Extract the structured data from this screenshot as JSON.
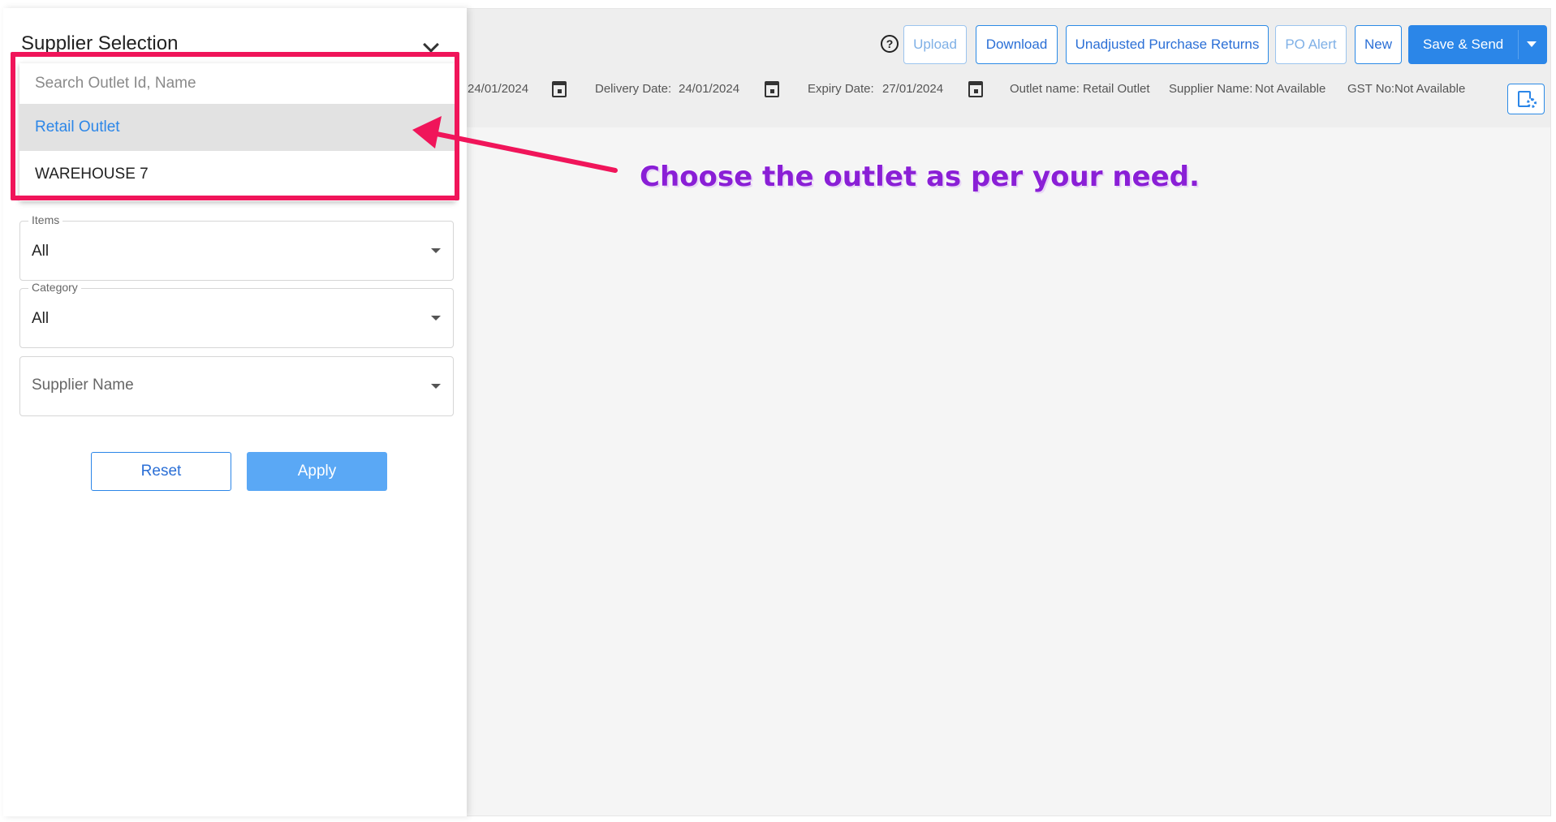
{
  "toolbar": {
    "help_icon": "?",
    "upload_label": "Upload",
    "download_label": "Download",
    "unadjusted_label": "Unadjusted Purchase Returns",
    "po_alert_label": "PO Alert",
    "new_label": "New",
    "save_send_label": "Save & Send"
  },
  "info": {
    "po_date_value": "24/01/2024",
    "delivery_label": "Delivery Date:",
    "delivery_value": "24/01/2024",
    "expiry_label": "Expiry Date:",
    "expiry_value": "27/01/2024",
    "outlet_label": "Outlet name:",
    "outlet_value": "Retail Outlet",
    "supplier_label": "Supplier Name:",
    "supplier_value": "Not Available",
    "gst_label": "GST No:",
    "gst_value": "Not Available"
  },
  "panel": {
    "title": "Supplier Selection",
    "items_legend": "Items",
    "items_value": "All",
    "category_legend": "Category",
    "category_value": "All",
    "supplier_placeholder": "Supplier Name",
    "reset_label": "Reset",
    "apply_label": "Apply"
  },
  "dropdown": {
    "search_placeholder": "Search Outlet Id, Name",
    "options": [
      {
        "label": "Retail Outlet",
        "selected": true
      },
      {
        "label": "WAREHOUSE 7",
        "selected": false
      }
    ]
  },
  "annotation": {
    "text": "Choose the outlet as per your  need.",
    "color": "#8a1fd6",
    "highlight_color": "#f0155a"
  },
  "colors": {
    "accent": "#2b86e8",
    "header_bg": "#eeeeee"
  }
}
